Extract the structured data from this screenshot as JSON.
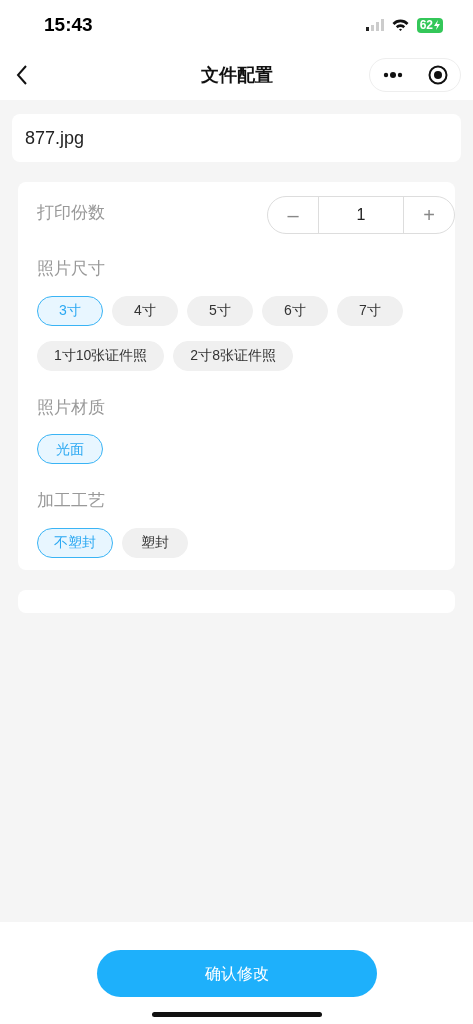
{
  "status_bar": {
    "time": "15:43",
    "battery": "62",
    "charging": true
  },
  "nav": {
    "title": "文件配置"
  },
  "file": {
    "name": "877.jpg"
  },
  "copies": {
    "label": "打印份数",
    "minus": "–",
    "value": "1",
    "plus": "+"
  },
  "groups": [
    {
      "label": "照片尺寸",
      "options": [
        {
          "label": "3寸",
          "selected": true
        },
        {
          "label": "4寸",
          "selected": false
        },
        {
          "label": "5寸",
          "selected": false
        },
        {
          "label": "6寸",
          "selected": false
        },
        {
          "label": "7寸",
          "selected": false
        },
        {
          "label": "1寸10张证件照",
          "selected": false
        },
        {
          "label": "2寸8张证件照",
          "selected": false
        }
      ]
    },
    {
      "label": "照片材质",
      "options": [
        {
          "label": "光面",
          "selected": true
        }
      ]
    },
    {
      "label": "加工工艺",
      "options": [
        {
          "label": "不塑封",
          "selected": true
        },
        {
          "label": "塑封",
          "selected": false
        }
      ]
    }
  ],
  "confirm_button": "确认修改"
}
